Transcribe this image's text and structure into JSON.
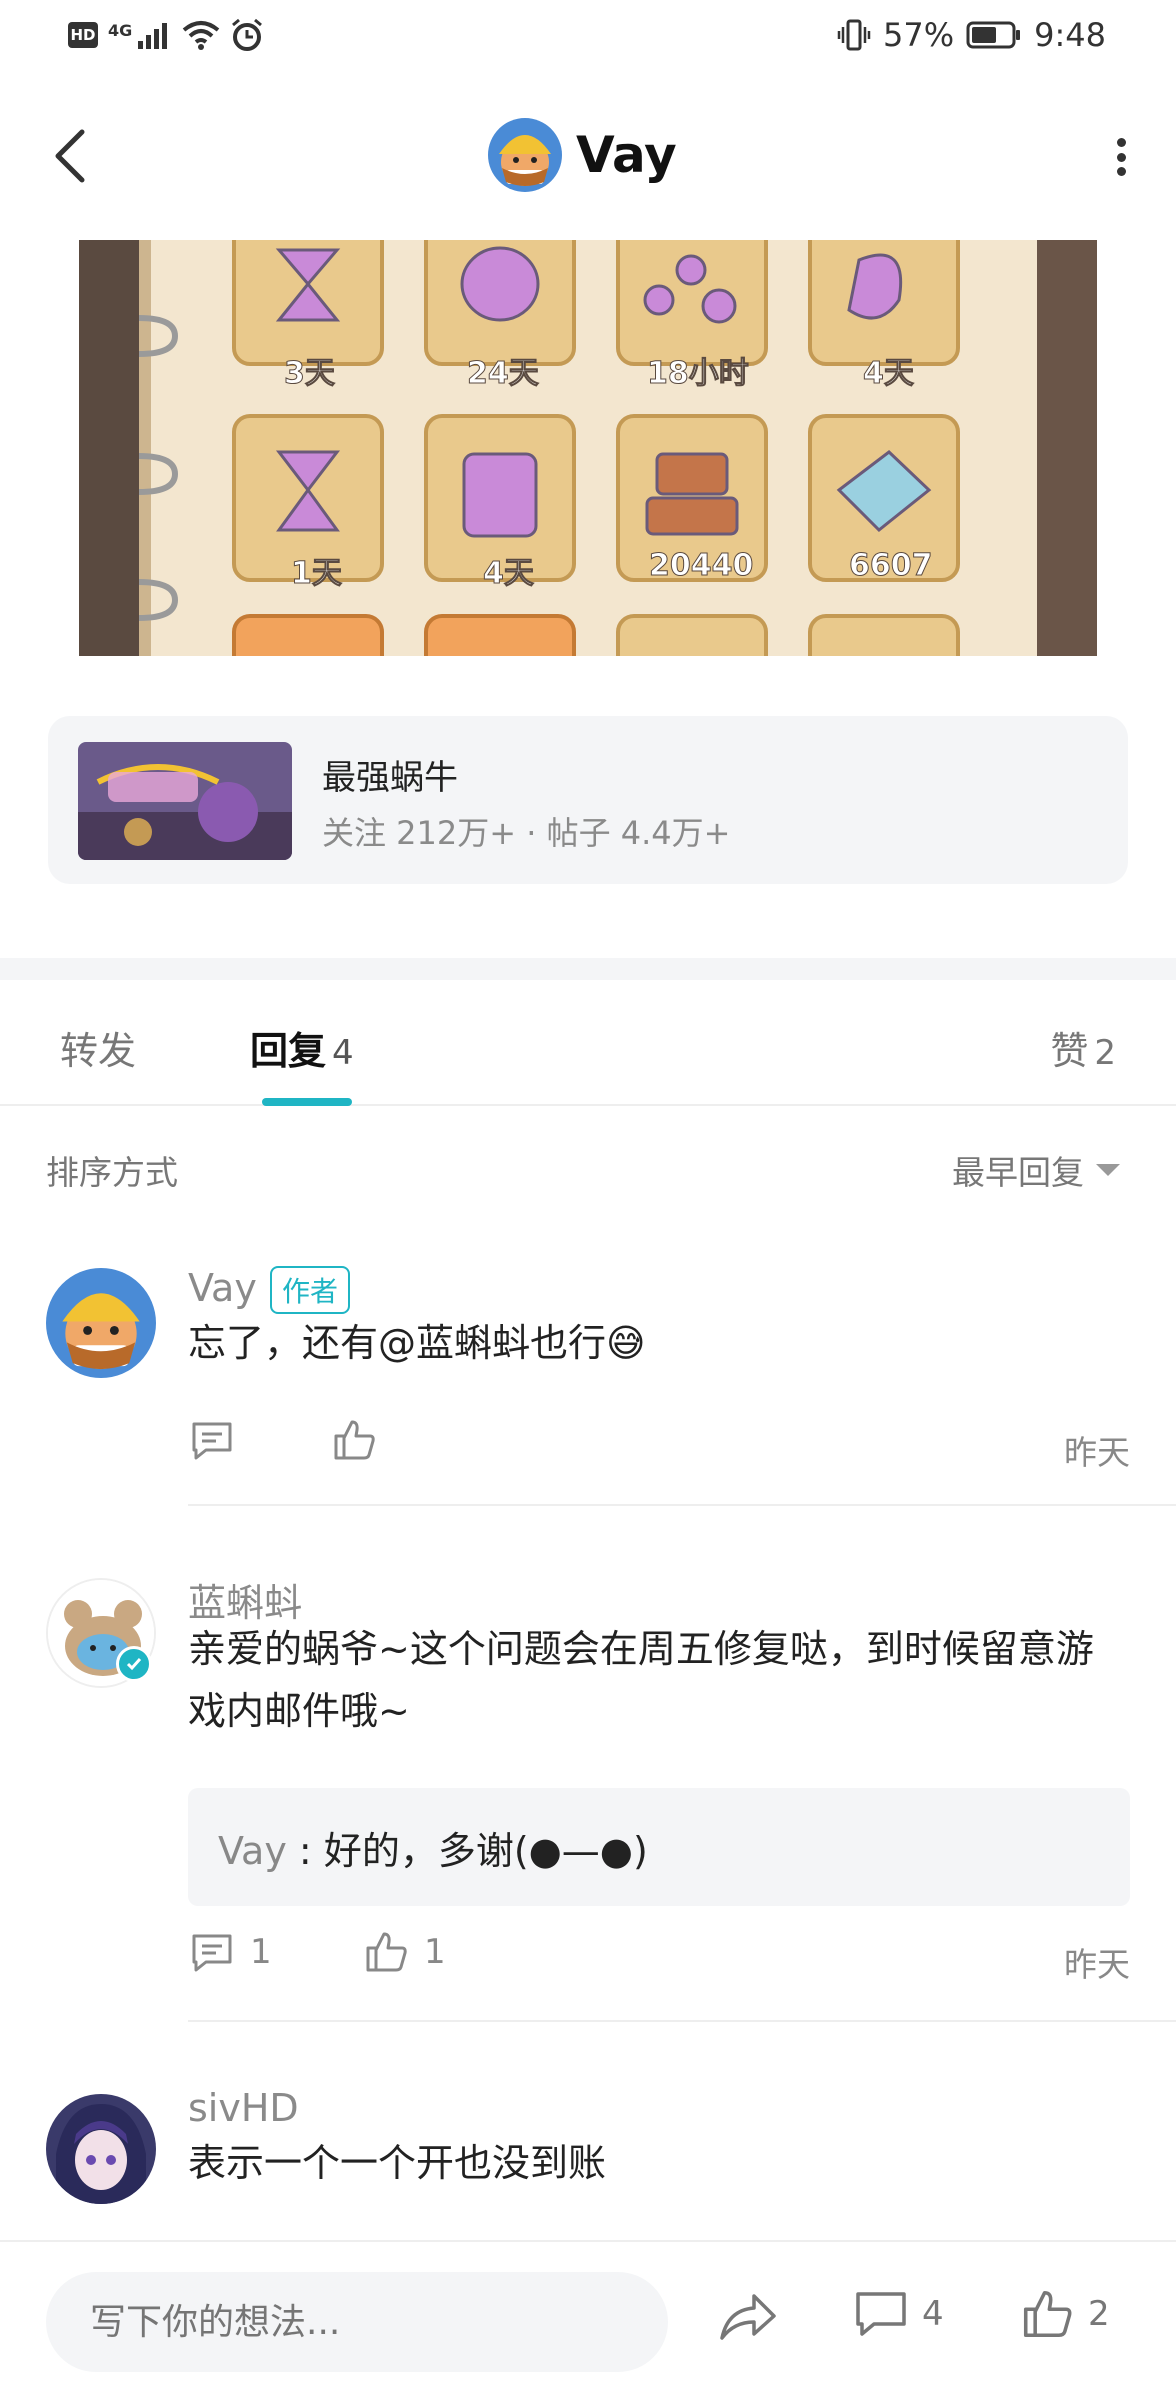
{
  "status_bar": {
    "hd": "HD",
    "network": "4G",
    "battery": "57%",
    "time": "9:48"
  },
  "header": {
    "title": "Vay"
  },
  "post_image": {
    "items": [
      {
        "label": "3天"
      },
      {
        "label": "24天"
      },
      {
        "label": "18小时"
      },
      {
        "label": "4天"
      },
      {
        "label": "1天"
      },
      {
        "label": "4天"
      },
      {
        "label": "20440"
      },
      {
        "label": "6607"
      }
    ]
  },
  "game_card": {
    "name": "最强蜗牛",
    "stats": "关注 212万+ · 帖子 4.4万+"
  },
  "tabs": {
    "repost": "转发",
    "reply": "回复",
    "reply_count": "4",
    "like": "赞",
    "like_count": "2"
  },
  "sort": {
    "label": "排序方式",
    "value": "最早回复"
  },
  "comments": [
    {
      "name": "Vay",
      "badge": "作者",
      "text": "忘了，还有@蓝蝌蚪也行😅",
      "time": "昨天"
    },
    {
      "name": "蓝蝌蚪",
      "text": "亲爱的蜗爷~这个问题会在周五修复哒，到时候留意游戏内邮件哦~",
      "quote_name": "Vay",
      "quote_text": "好的，多谢(●—●)",
      "reply_count": "1",
      "like_count": "1",
      "time": "昨天"
    },
    {
      "name": "sivHD",
      "text": "表示一个一个开也没到账"
    }
  ],
  "bottom_bar": {
    "placeholder": "写下你的想法...",
    "comment_count": "4",
    "like_count": "2"
  },
  "colors": {
    "accent": "#1fb5c4",
    "background": "#ffffff",
    "panel": "#f4f5f7"
  }
}
